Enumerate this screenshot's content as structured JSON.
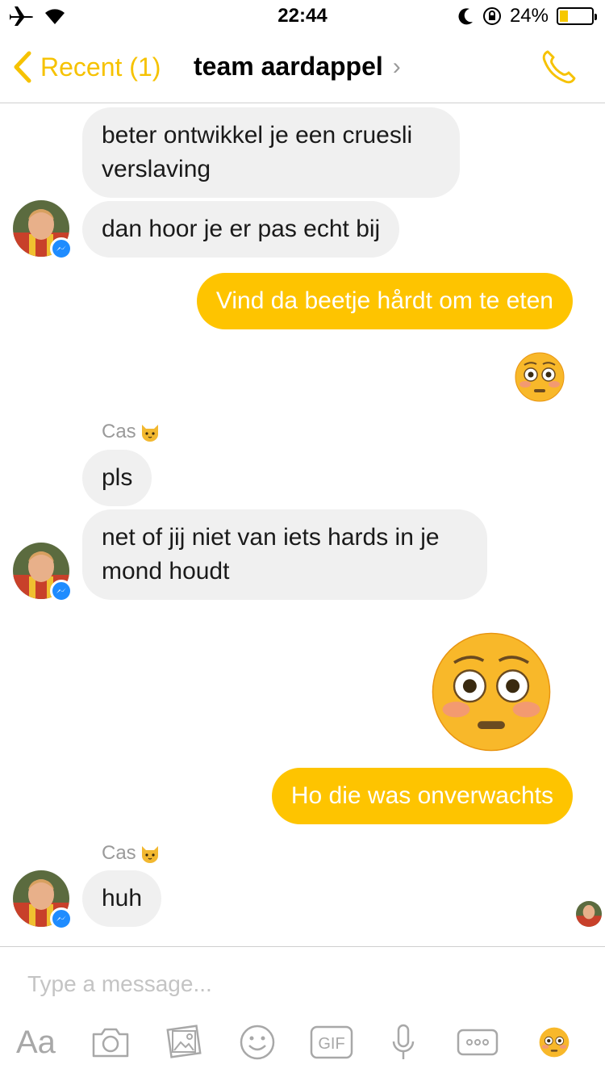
{
  "status_bar": {
    "time": "22:44",
    "battery": "24%",
    "battery_level": 0.24
  },
  "header": {
    "back_label": "Recent (1)",
    "title": "team aardappel"
  },
  "messages": [
    {
      "type": "incoming",
      "text": "beter ontwikkel je een cruesli verslaving"
    },
    {
      "type": "incoming",
      "text": "dan hoor je er pas echt bij"
    },
    {
      "type": "outgoing",
      "text": "Vind da beetje hårdt om te eten"
    },
    {
      "type": "outgoing-emoji",
      "icon": "flushed-face-emoji"
    },
    {
      "type": "sender",
      "name": "Cas"
    },
    {
      "type": "incoming",
      "text": "pls"
    },
    {
      "type": "incoming",
      "text": "net of jij niet van iets hards in je mond houdt"
    },
    {
      "type": "outgoing-emoji",
      "icon": "flushed-face-emoji-large"
    },
    {
      "type": "outgoing",
      "text": "Ho die was onverwachts"
    },
    {
      "type": "sender",
      "name": "Cas"
    },
    {
      "type": "incoming",
      "text": "huh"
    }
  ],
  "composer": {
    "placeholder": "Type a message...",
    "aa_label": "Aa",
    "gif_label": "GIF",
    "icons": [
      "camera-icon",
      "gallery-icon",
      "smiley-icon",
      "gif-icon",
      "microphone-icon",
      "more-icon",
      "flushed-emoji-icon"
    ]
  },
  "colors": {
    "accent": "#fec400",
    "incoming_bubble": "#f0f0f0",
    "messenger_badge": "#1f8cff"
  }
}
